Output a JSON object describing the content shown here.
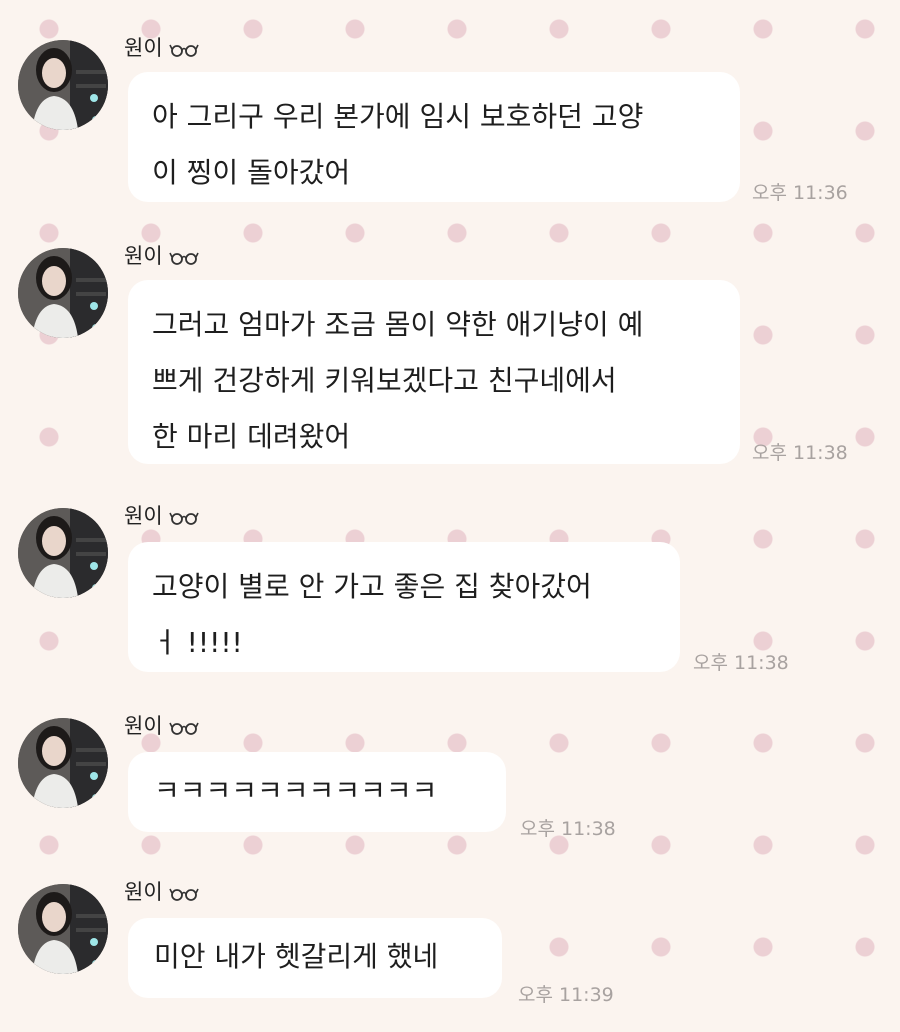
{
  "messages": [
    {
      "sender": "원이",
      "sender_icon": "glasses-icon",
      "text": "아 그리구 우리 본가에 임시 보호하던 고양\n이 찡이 돌아갔어",
      "time": "오후 11:36"
    },
    {
      "sender": "원이",
      "sender_icon": "glasses-icon",
      "text": "그러고 엄마가 조금 몸이 약한 애기냥이 예\n쁘게 건강하게  키워보겠다고 친구네에서\n한 마리 데려왔어",
      "time": "오후 11:38"
    },
    {
      "sender": "원이",
      "sender_icon": "glasses-icon",
      "text": "고양이 별로 안 가고 좋은 집 찾아갔어\nㅓ !!!!!",
      "time": "오후 11:38"
    },
    {
      "sender": "원이",
      "sender_icon": "glasses-icon",
      "text": "ㅋㅋㅋㅋㅋㅋㅋㅋㅋㅋㅋ",
      "time": "오후 11:38"
    },
    {
      "sender": "원이",
      "sender_icon": "glasses-icon",
      "text": "미안 내가 헷갈리게 했네",
      "time": "오후 11:39"
    }
  ],
  "colors": {
    "background": "#fbf4ef",
    "polka_dot": "#ecd0d4",
    "bubble": "#ffffff",
    "timestamp": "#a8a2a0"
  }
}
